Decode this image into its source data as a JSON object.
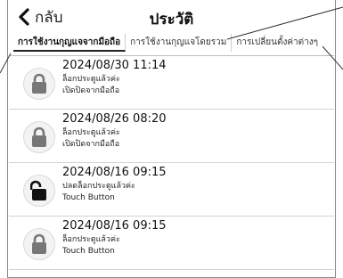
{
  "header": {
    "back_label": "กลับ",
    "title": "ประวัติ"
  },
  "tabs": [
    {
      "label": "การใช้งานกุญแจจากมือถือ",
      "active": true
    },
    {
      "label": "การใช้งานกุญแจโดยรวม",
      "active": false
    },
    {
      "label": "การเปลี่ยนตั้งค่าต่างๆ",
      "active": false
    }
  ],
  "history": [
    {
      "datetime": "2024/08/30 11:14",
      "status": "ล็อกประตูแล้วค่ะ",
      "source": "เปิดปิดจากมือถือ",
      "icon": "lock-closed-icon"
    },
    {
      "datetime": "2024/08/26 08:20",
      "status": "ล็อกประตูแล้วค่ะ",
      "source": "เปิดปิดจากมือถือ",
      "icon": "lock-closed-icon"
    },
    {
      "datetime": "2024/08/16 09:15",
      "status": "ปลดล็อกประตูแล้วค่ะ",
      "source": "Touch Button",
      "icon": "lock-open-icon"
    },
    {
      "datetime": "2024/08/16 09:15",
      "status": "ล็อกประตูแล้วค่ะ",
      "source": "Touch Button",
      "icon": "lock-closed-icon"
    }
  ],
  "colors": {
    "lock_closed": "#777777",
    "lock_open": "#111111",
    "divider": "#d2d2d2"
  }
}
